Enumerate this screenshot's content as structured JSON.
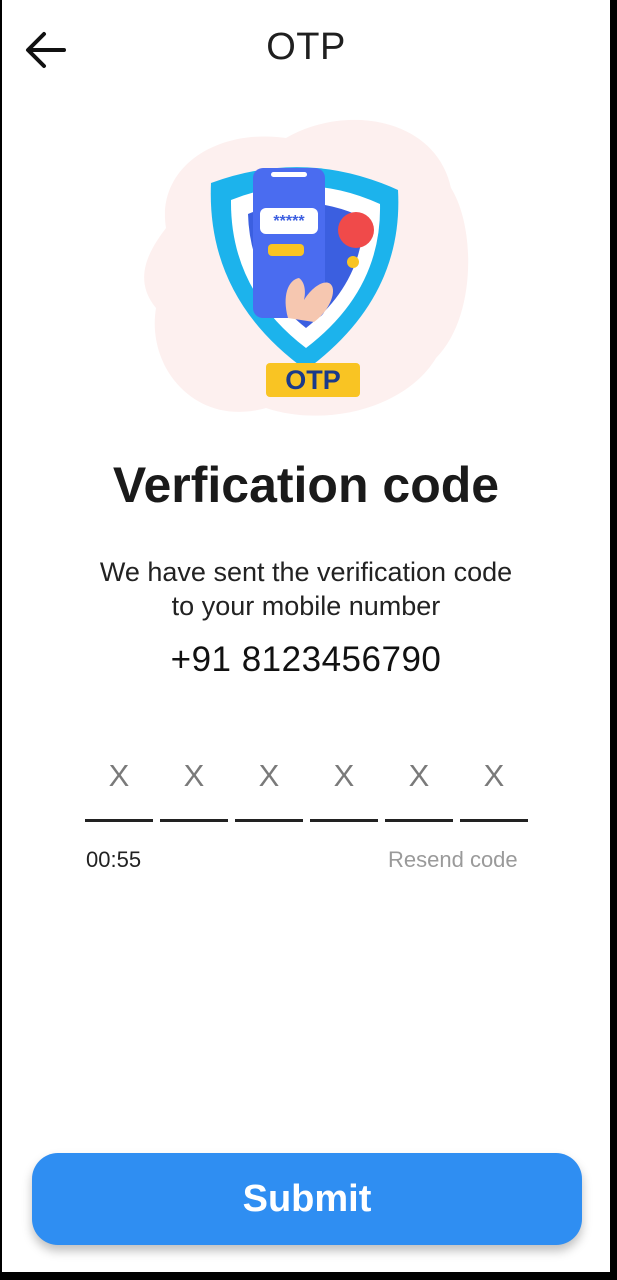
{
  "header": {
    "back_icon": "arrow-left-icon",
    "title": "OTP"
  },
  "illustration": {
    "badge": "OTP",
    "masked_code": "*****"
  },
  "content": {
    "heading": "Verfication code",
    "description_line1": "We have sent the verification code",
    "description_line2": "to your mobile number",
    "phone_number": "+91 8123456790"
  },
  "otp": {
    "digits": [
      "X",
      "X",
      "X",
      "X",
      "X",
      "X"
    ]
  },
  "timer": "00:55",
  "resend_label": "Resend code",
  "submit_label": "Submit",
  "colors": {
    "primary": "#2f8ef2",
    "badge": "#f9c423",
    "shield": "#1cb3ec",
    "phone": "#3d5fe0",
    "dot": "#f04a4a"
  }
}
